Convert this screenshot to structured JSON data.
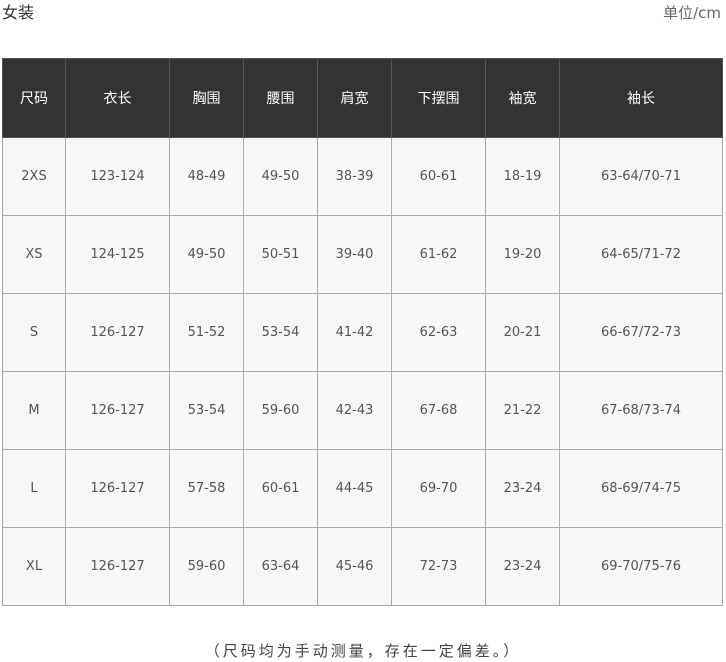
{
  "title": "女装",
  "unit": "单位/cm",
  "table": {
    "headers": [
      "尺码",
      "衣长",
      "胸围",
      "腰围",
      "肩宽",
      "下摆围",
      "袖宽",
      "袖长"
    ],
    "rows": [
      [
        "2XS",
        "123-124",
        "48-49",
        "49-50",
        "38-39",
        "60-61",
        "18-19",
        "63-64/70-71"
      ],
      [
        "XS",
        "124-125",
        "49-50",
        "50-51",
        "39-40",
        "61-62",
        "19-20",
        "64-65/71-72"
      ],
      [
        "S",
        "126-127",
        "51-52",
        "53-54",
        "41-42",
        "62-63",
        "20-21",
        "66-67/72-73"
      ],
      [
        "M",
        "126-127",
        "53-54",
        "59-60",
        "42-43",
        "67-68",
        "21-22",
        "67-68/73-74"
      ],
      [
        "L",
        "126-127",
        "57-58",
        "60-61",
        "44-45",
        "69-70",
        "23-24",
        "68-69/74-75"
      ],
      [
        "XL",
        "126-127",
        "59-60",
        "63-64",
        "45-46",
        "72-73",
        "23-24",
        "69-70/75-76"
      ]
    ]
  },
  "note": "（尺码均为手动测量，存在一定偏差。）"
}
